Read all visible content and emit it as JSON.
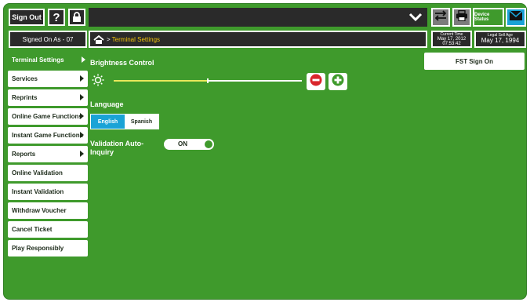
{
  "topbar": {
    "signout_label": "Sign Out",
    "help_label": "?",
    "device_status_label": "Device Status"
  },
  "session": {
    "signed_on_label": "Signed On As - 07",
    "breadcrumb": "Terminal Settings",
    "current_time_label": "Current Time",
    "current_date": "May 17, 2012",
    "current_time": "07:53:42",
    "legal_age_label": "Legal Sell Age",
    "legal_age_date": "May 17, 1994"
  },
  "sidebar": {
    "items": [
      {
        "label": "Terminal Settings",
        "has_arrow": true,
        "active": true
      },
      {
        "label": "Services",
        "has_arrow": true,
        "active": false
      },
      {
        "label": "Reprints",
        "has_arrow": true,
        "active": false
      },
      {
        "label": "Online Game Functions",
        "has_arrow": true,
        "active": false
      },
      {
        "label": "Instant Game Functions",
        "has_arrow": true,
        "active": false
      },
      {
        "label": "Reports",
        "has_arrow": true,
        "active": false
      },
      {
        "label": "Online Validation",
        "has_arrow": false,
        "active": false
      },
      {
        "label": "Instant Validation",
        "has_arrow": false,
        "active": false
      },
      {
        "label": "Withdraw Voucher",
        "has_arrow": false,
        "active": false
      },
      {
        "label": "Cancel Ticket",
        "has_arrow": false,
        "active": false
      },
      {
        "label": "Play Responsibly",
        "has_arrow": false,
        "active": false
      }
    ]
  },
  "settings": {
    "brightness_label": "Brightness Control",
    "brightness_level": 0.5,
    "language_label": "Language",
    "language_options": [
      "English",
      "Spanish"
    ],
    "language_selected": "English",
    "validation_label": "Validation Auto-Inquiry",
    "validation_state": "ON"
  },
  "fst_sign_on_label": "FST Sign On",
  "colors": {
    "brand_green": "#3f9a2c",
    "dark": "#2a2a2a",
    "accent_blue": "#1aa3d6",
    "breadcrumb_yellow": "#f2c40b",
    "slider_yellow": "#e8e85a",
    "minus_red": "#d9262c",
    "plus_green": "#3f9a2c"
  },
  "icons": {
    "lock": "lock-icon",
    "chevron": "chevron-down-icon",
    "swap": "swap-arrows-icon",
    "print": "printer-icon",
    "mail": "mail-icon",
    "home": "home-icon",
    "brightness": "sun-icon",
    "minus": "minus-circle-icon",
    "plus": "plus-circle-icon"
  }
}
